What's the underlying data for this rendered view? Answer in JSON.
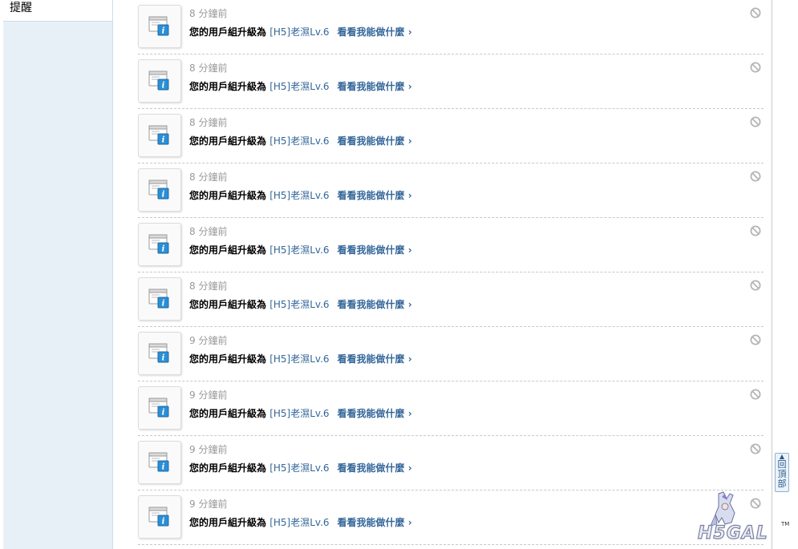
{
  "sidebar": {
    "items": [
      {
        "label": "提醒"
      }
    ]
  },
  "notifications": [
    {
      "time": "8 分鐘前",
      "prefix": "您的用戶組升級為 ",
      "group": "[H5]老濕Lv.6",
      "action": "看看我能做什麼 ›"
    },
    {
      "time": "8 分鐘前",
      "prefix": "您的用戶組升級為 ",
      "group": "[H5]老濕Lv.6",
      "action": "看看我能做什麼 ›"
    },
    {
      "time": "8 分鐘前",
      "prefix": "您的用戶組升級為 ",
      "group": "[H5]老濕Lv.6",
      "action": "看看我能做什麼 ›"
    },
    {
      "time": "8 分鐘前",
      "prefix": "您的用戶組升級為 ",
      "group": "[H5]老濕Lv.6",
      "action": "看看我能做什麼 ›"
    },
    {
      "time": "8 分鐘前",
      "prefix": "您的用戶組升級為 ",
      "group": "[H5]老濕Lv.6",
      "action": "看看我能做什麼 ›"
    },
    {
      "time": "8 分鐘前",
      "prefix": "您的用戶組升級為 ",
      "group": "[H5]老濕Lv.6",
      "action": "看看我能做什麼 ›"
    },
    {
      "time": "9 分鐘前",
      "prefix": "您的用戶組升級為 ",
      "group": "[H5]老濕Lv.6",
      "action": "看看我能做什麼 ›"
    },
    {
      "time": "9 分鐘前",
      "prefix": "您的用戶組升級為 ",
      "group": "[H5]老濕Lv.6",
      "action": "看看我能做什麼 ›"
    },
    {
      "time": "9 分鐘前",
      "prefix": "您的用戶組升級為 ",
      "group": "[H5]老濕Lv.6",
      "action": "看看我能做什麼 ›"
    },
    {
      "time": "9 分鐘前",
      "prefix": "您的用戶組升級為 ",
      "group": "[H5]老濕Lv.6",
      "action": "看看我能做什麼 ›"
    }
  ],
  "icons": {
    "notice": "system-notice-icon",
    "ignore": "ignore-icon"
  },
  "back_to_top": {
    "label": "回頂部"
  },
  "logo": {
    "text": "H5GAL",
    "mark": "TM"
  },
  "colors": {
    "link": "#336699",
    "sidebar_bg": "#e8f0f7",
    "time": "#999999"
  }
}
